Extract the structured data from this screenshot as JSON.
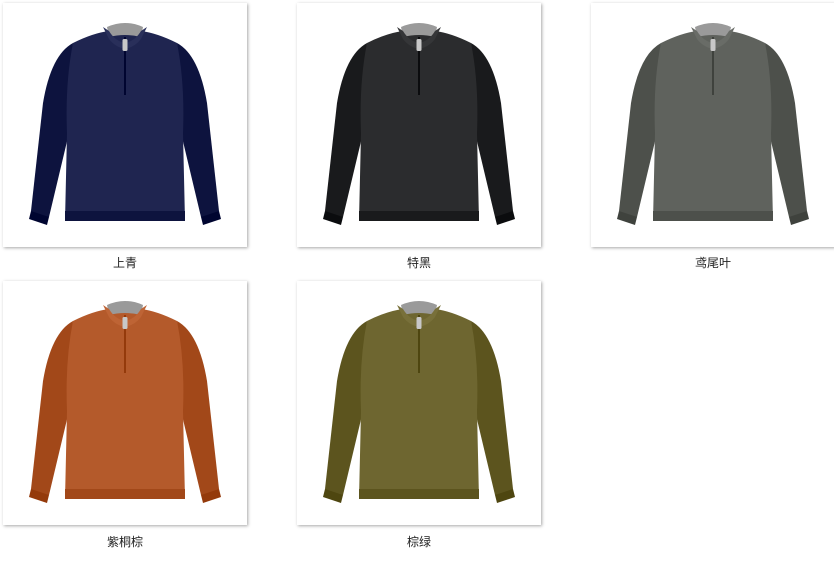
{
  "products": [
    {
      "label": "上青",
      "color": "#1f2550"
    },
    {
      "label": "特黑",
      "color": "#2b2c2e"
    },
    {
      "label": "鸢尾叶",
      "color": "#5f625d"
    },
    {
      "label": "紫桐棕",
      "color": "#b45a2b"
    },
    {
      "label": "棕绿",
      "color": "#6e6630"
    }
  ]
}
